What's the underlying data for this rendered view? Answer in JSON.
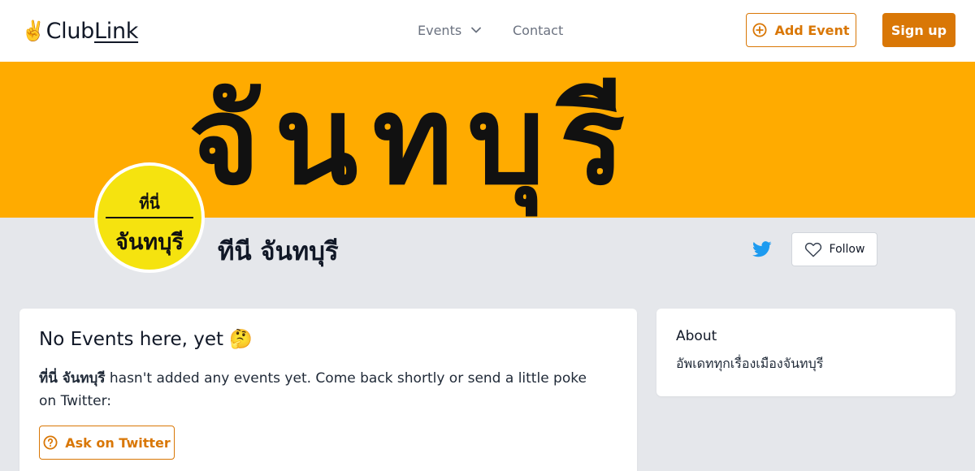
{
  "header": {
    "logo_prefix": "Club",
    "logo_suffix": "Link",
    "logo_emoji": "✌️",
    "nav": {
      "events_label": "Events",
      "contact_label": "Contact"
    },
    "add_event_label": "Add Event",
    "signup_label": "Sign up"
  },
  "banner": {
    "text": "จันทบุรี"
  },
  "profile": {
    "avatar_top": "ที่นี่",
    "avatar_bottom": "จันทบุรี",
    "name": "ทีนี จันทบุรี",
    "follow_label": "Follow"
  },
  "main": {
    "title": "No Events here, yet 🤔",
    "desc_name": "ที่นี่ จันทบุรี",
    "desc_text": " hasn't added any events yet. Come back shortly or send a little poke on Twitter:",
    "ask_label": "Ask on Twitter"
  },
  "about": {
    "title": "About",
    "text": "อัพเดททุกเรื่องเมืองจันทบุรี"
  },
  "colors": {
    "accent": "#d97706",
    "banner": "#ffab00",
    "avatar_bg": "#f5e30f",
    "twitter": "#1d9bf0"
  },
  "icons": [
    "chevron-down-icon",
    "plus-circle-icon",
    "twitter-icon",
    "heart-icon",
    "question-circle-icon"
  ]
}
